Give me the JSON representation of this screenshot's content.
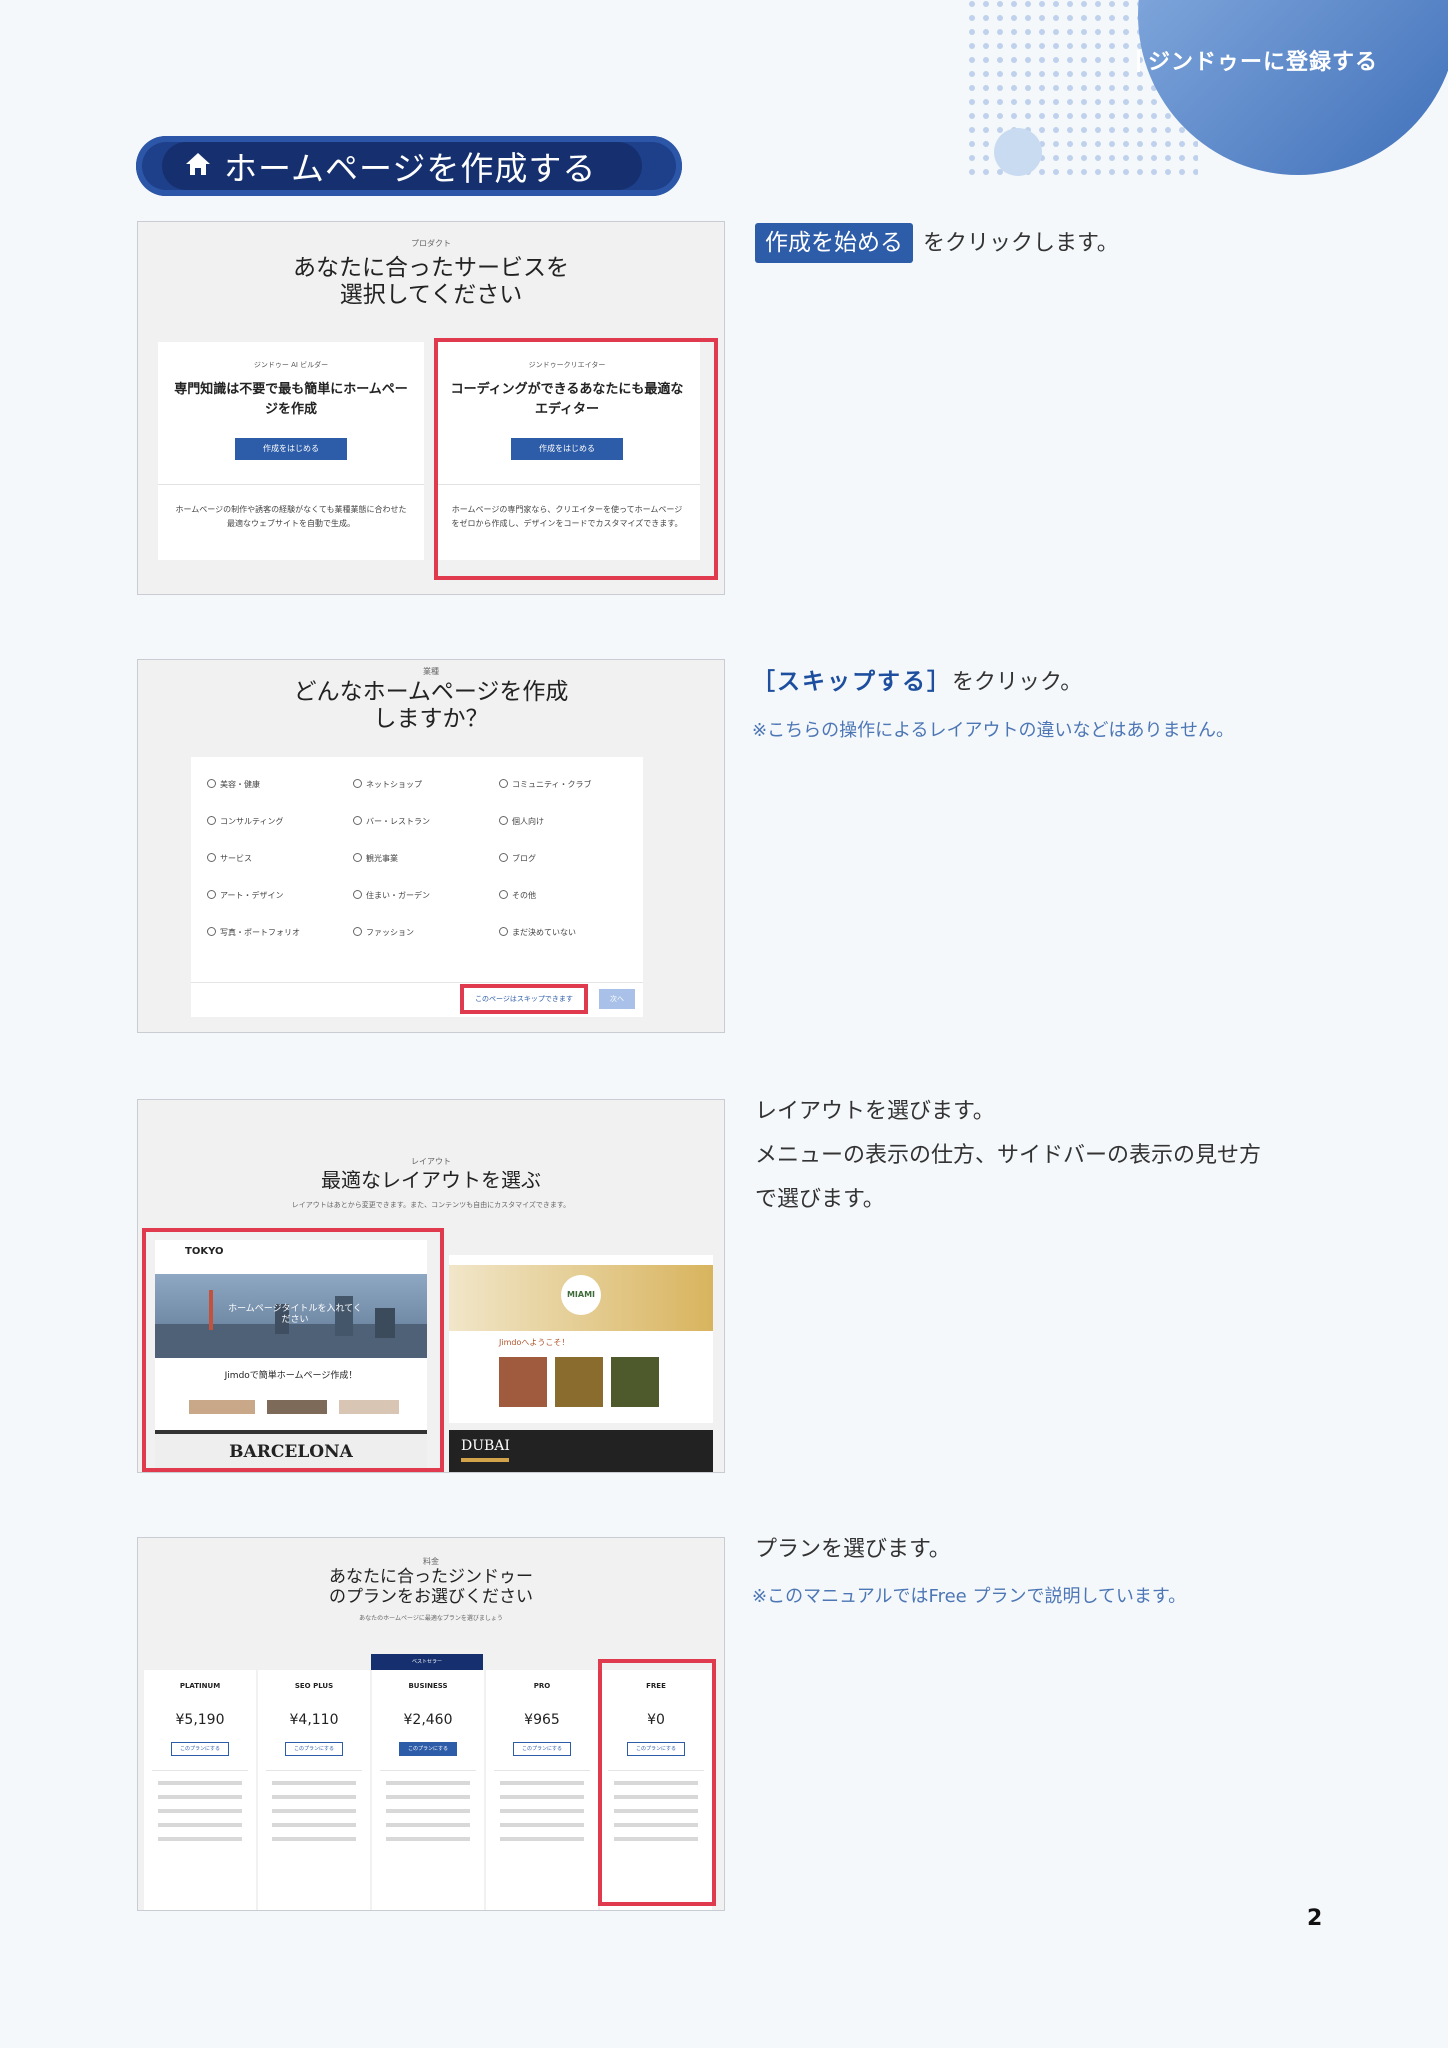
{
  "header": {
    "chapter": "ジンドゥーに登録する",
    "section_title": "ホームページを作成する",
    "section_icon": "home-icon"
  },
  "step1": {
    "screen_label": "プロダクト",
    "screen_heading_1": "あなたに合ったサービスを",
    "screen_heading_2": "選択してください",
    "cards": [
      {
        "small": "ジンドゥー AI ビルダー",
        "title": "専門知識は不要で最も簡単にホームページを作成",
        "button": "作成をはじめる",
        "desc": "ホームページの制作や誘客の経験がなくても業種業態に合わせた最適なウェブサイトを自動で生成。"
      },
      {
        "small": "ジンドゥークリエイター",
        "title": "コーディングができるあなたにも最適なエディター",
        "button": "作成をはじめる",
        "desc": "ホームページの専門家なら、クリエイターを使ってホームページをゼロから作成し、デザインをコードでカスタマイズできます。"
      }
    ],
    "button_name": "作成を始める",
    "instruction": "をクリックします。"
  },
  "step2": {
    "screen_label": "業種",
    "screen_heading_1": "どんなホームページを作成",
    "screen_heading_2": "しますか？",
    "options": [
      "美容・健康",
      "ネットショップ",
      "コミュニティ・クラブ",
      "コンサルティング",
      "バー・レストラン",
      "個人向け",
      "サービス",
      "観光事業",
      "ブログ",
      "アート・デザイン",
      "住まい・ガーデン",
      "その他",
      "写真・ポートフォリオ",
      "ファッション",
      "まだ決めていない"
    ],
    "skip_button": "このページはスキップできます",
    "next_button": "次へ",
    "skip_label": "［スキップする］",
    "instruction": "をクリック。",
    "note": "※こちらの操作によるレイアウトの違いなどはありません。"
  },
  "step3": {
    "screen_label": "レイアウト",
    "screen_heading": "最適なレイアウトを選ぶ",
    "screen_sub": "レイアウトはあとから変更できます。また、コンテンツも自由にカスタマイズできます。",
    "layouts": {
      "tokyo": "TOKYO",
      "tokyo_hero": "ホームページタイトルを入れてください",
      "tokyo_text": "Jimdoで簡単ホームページ作成！",
      "miami": "MIAMI",
      "miami_text": "Jimdoへようこそ！",
      "barcelona": "BARCELONA",
      "dubai": "DUBAI"
    },
    "line1": "レイアウトを選びます。",
    "line2": "メニューの表示の仕方、サイドバーの表示の見せ方",
    "line3": "で選びます。"
  },
  "step4": {
    "screen_label": "料金",
    "screen_heading_1": "あなたに合ったジンドゥー",
    "screen_heading_2": "のプランをお選びください",
    "screen_sub": "あなたのホームページに最適なプランを選びましょう",
    "badge": "ベストセラー",
    "plans": [
      {
        "name": "PLATINUM",
        "price": "¥5,190"
      },
      {
        "name": "SEO PLUS",
        "price": "¥4,110"
      },
      {
        "name": "BUSINESS",
        "price": "¥2,460"
      },
      {
        "name": "PRO",
        "price": "¥965"
      },
      {
        "name": "FREE",
        "price": "¥0"
      }
    ],
    "plan_button": "このプランにする",
    "line1": "プランを選びます。",
    "note": "※このマニュアルではFree プランで説明しています。"
  },
  "page_number": "2"
}
